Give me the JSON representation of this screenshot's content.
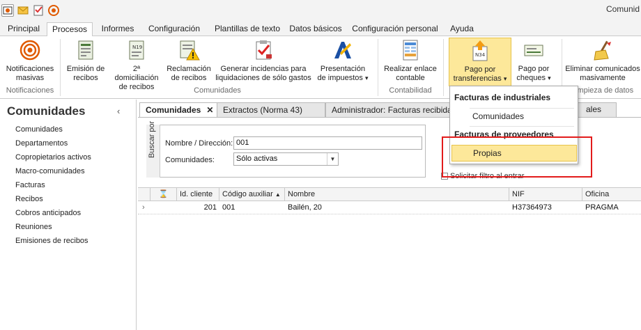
{
  "window": {
    "title": "Comunid"
  },
  "ribbon_tabs": [
    "Principal",
    "Procesos",
    "Informes",
    "Configuración",
    "Plantillas de texto",
    "Datos básicos",
    "Configuración personal",
    "Ayuda"
  ],
  "ribbon": {
    "notif": {
      "line1": "Notificaciones",
      "line2": "masivas",
      "group": "Notificaciones"
    },
    "emision": {
      "line1": "Emisión de",
      "line2": "recibos"
    },
    "domiciliacion": {
      "line1": "2ª domiciliación",
      "line2": "de recibos",
      "icon_text": "N19"
    },
    "reclamacion": {
      "line1": "Reclamación",
      "line2": "de recibos"
    },
    "incidencias": {
      "line1": "Generar incidencias para",
      "line2": "liquidaciones de sólo gastos"
    },
    "impuestos": {
      "line1": "Presentación",
      "line2": "de impuestos",
      "caret": "▾"
    },
    "group_comunidades": "Comunidades",
    "enlace": {
      "line1": "Realizar enlace",
      "line2": "contable",
      "group": "Contabilidad"
    },
    "transferencias": {
      "line1": "Pago por",
      "line2": "transferencias",
      "caret": "▾",
      "icon_text": "N34"
    },
    "cheques": {
      "line1": "Pago por",
      "line2": "cheques",
      "caret": "▾"
    },
    "eliminar": {
      "line1": "Eliminar comunicados",
      "line2": "masivamente",
      "group": "impieza de datos"
    }
  },
  "left_panel": {
    "title": "Comunidades",
    "collapse": "‹",
    "items": [
      "Comunidades",
      "Departamentos",
      "Copropietarios activos",
      "Macro-comunidades",
      "Facturas",
      "Recibos",
      "Cobros anticipados",
      "Reuniones",
      "Emisiones de recibos"
    ]
  },
  "doc_tabs": {
    "active": "Comunidades",
    "close": "✕",
    "tab2": "Extractos (Norma 43)",
    "tab3": "Administrador: Facturas recibidas",
    "tab4": "ales"
  },
  "search": {
    "vertical_label": "Buscar por",
    "name_label": "Nombre / Dirección:",
    "name_value": "001",
    "communities_label": "Comunidades:",
    "communities_value": "Sólo activas",
    "filter_check": "Solicitar filtro al entrar"
  },
  "grid": {
    "columns": [
      "Id. cliente",
      "Código auxiliar",
      "Nombre",
      "NIF",
      "Oficina"
    ],
    "sort_indicator": "▲",
    "hourglass": "⌛",
    "row_marker": "›",
    "rows": [
      {
        "id": "201",
        "codigo": "001",
        "nombre": "Bailén, 20",
        "nif": "H37364973",
        "oficina": "PRAGMA"
      }
    ]
  },
  "dropdown": {
    "header1": "Facturas de industriales",
    "item1": "Comunidades",
    "header2": "Facturas de proveedores",
    "item2": "Propias"
  },
  "colors": {
    "highlight": "#fde89a",
    "annotation": "#e21b1b"
  }
}
